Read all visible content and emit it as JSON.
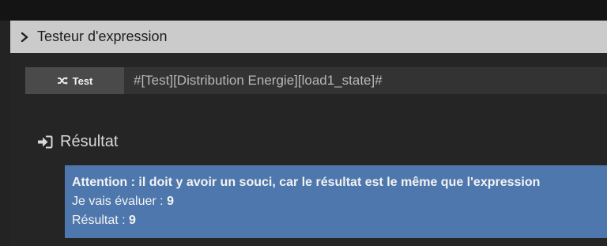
{
  "panel": {
    "title": "Testeur d'expression"
  },
  "test": {
    "button_label": "Test",
    "expression_value": "#[Test][Distribution Energie][load1_state]#"
  },
  "result": {
    "title": "Résultat",
    "warning": "Attention : il doit y avoir un souci, car le résultat est le même que l'expression",
    "evaluating_label": "Je vais évaluer : ",
    "evaluating_value": "9",
    "result_label": "Résultat : ",
    "result_value": "9"
  },
  "colors": {
    "header_bg": "#cbcbcb",
    "alert_bg": "#4e78ad",
    "button_bg": "#4a4a4a"
  },
  "icons": {
    "header": "chevron-right-icon",
    "test_button": "random-icon",
    "result_title": "sign-in-icon"
  }
}
